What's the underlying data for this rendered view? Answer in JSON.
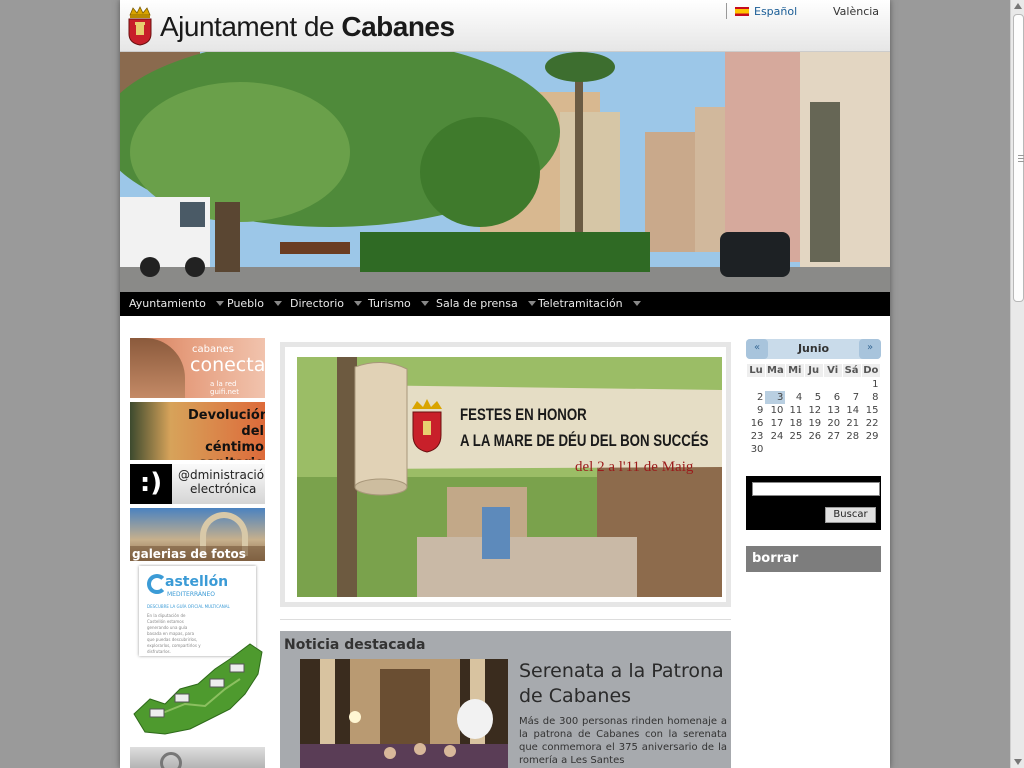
{
  "header": {
    "title_light": "Ajuntament de ",
    "title_bold": "Cabanes",
    "languages": [
      "Español",
      "València"
    ]
  },
  "nav": {
    "items": [
      "Ayuntamiento",
      "Pueblo",
      "Directorio",
      "Turismo",
      "Sala de prensa",
      "Teletramitación"
    ]
  },
  "left_banners": {
    "conecta_small": "cabanes",
    "conecta_big": "conecta",
    "conecta_sub": "a la red guifi.net",
    "devolucion": [
      "Devolución",
      "del céntimo",
      "sanitario"
    ],
    "admin_face": ":)",
    "admin_text": [
      "@dministración",
      "electrónica"
    ],
    "galerias": "galerias de fotos",
    "castellon_title": "astellón",
    "castellon_sub": "MEDITERRÁNEO",
    "castellon_tag": "DESCUBRE LA GUÍA OFICIAL MULTICANAL",
    "castellon_body": "En la diputación de Castellón estamos generando una guía basada en mapas, para que puedas descubrirlos, explorarlos, compartirlos y disfrutarlos."
  },
  "feature": {
    "poster_line1": "FESTES EN HONOR",
    "poster_line2": "A LA MARE DE DÉU DEL BON SUCCÉS",
    "poster_dates": "del  2 a l'11 de Maig"
  },
  "noticia": {
    "section_title": "Noticia destacada",
    "headline": "Serenata a la Patrona de Cabanes",
    "summary": "Más de 300 personas rinden homenaje a la patrona de Cabanes con la serenata que conmemora el 375 aniversario de la romería a Les Santes"
  },
  "calendar": {
    "month": "Junio",
    "prev": "«",
    "next": "»",
    "weekdays": [
      "Lu",
      "Ma",
      "Mi",
      "Ju",
      "Vi",
      "Sá",
      "Do"
    ],
    "weeks": [
      [
        "",
        "",
        "",
        "",
        "",
        "",
        "1"
      ],
      [
        "2",
        "3",
        "4",
        "5",
        "6",
        "7",
        "8"
      ],
      [
        "9",
        "10",
        "11",
        "12",
        "13",
        "14",
        "15"
      ],
      [
        "16",
        "17",
        "18",
        "19",
        "20",
        "21",
        "22"
      ],
      [
        "23",
        "24",
        "25",
        "26",
        "27",
        "28",
        "29"
      ],
      [
        "30",
        "",
        "",
        "",
        "",
        "",
        ""
      ]
    ],
    "today": "3"
  },
  "search": {
    "button_label": "Buscar",
    "value": ""
  },
  "borrar_label": "borrar",
  "colors": {
    "nav_bg": "#000000",
    "link_blue": "#1a5d96",
    "noticia_bg": "#a7aaae",
    "calendar_header": "#c9dbea"
  }
}
